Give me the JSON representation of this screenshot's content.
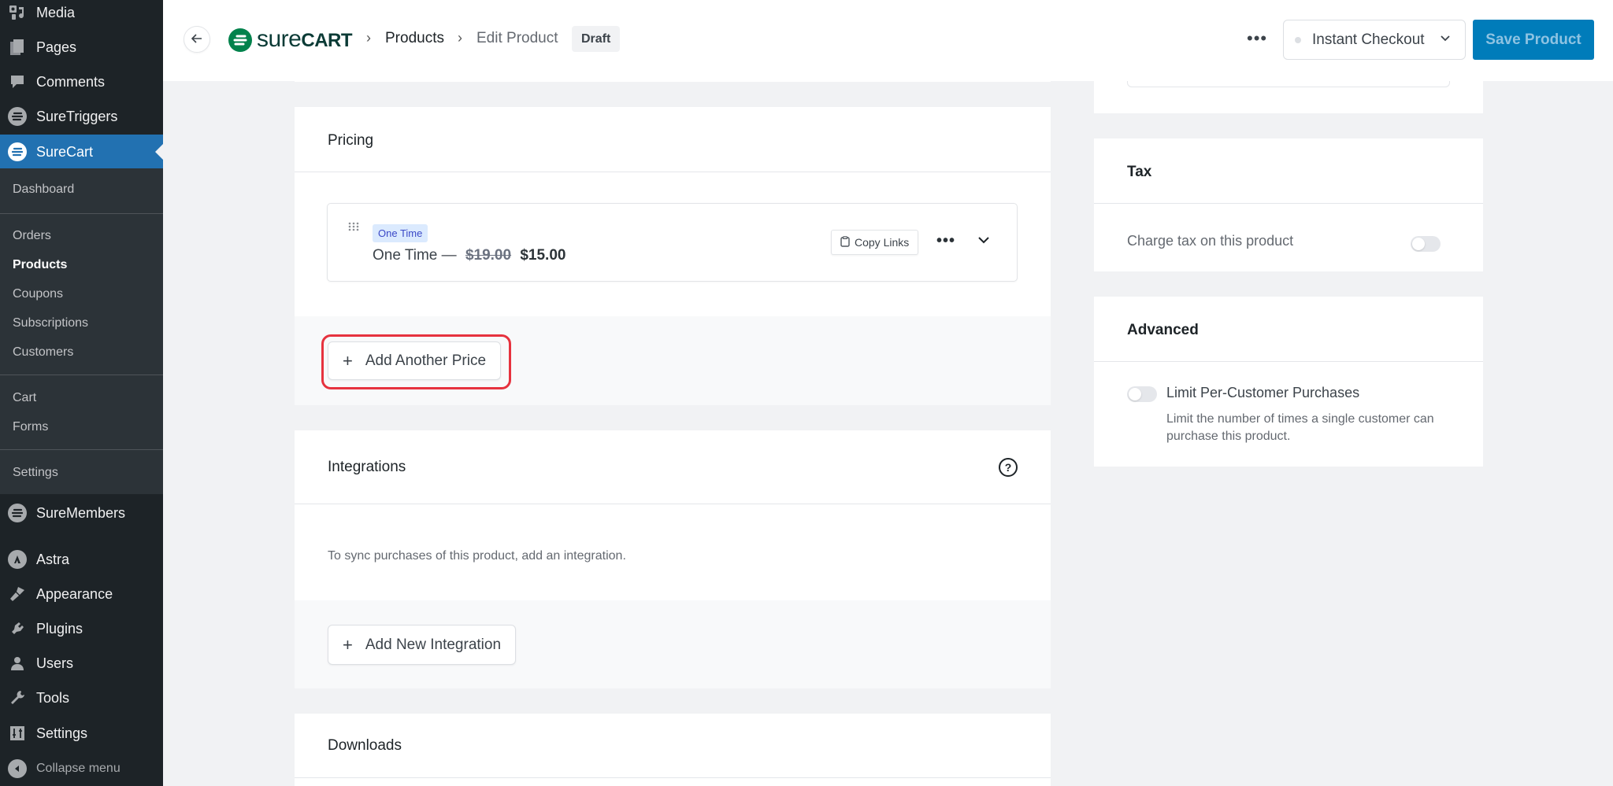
{
  "sidebar": {
    "items": [
      {
        "label": "Media",
        "icon": "media-icon"
      },
      {
        "label": "Pages",
        "icon": "pages-icon"
      },
      {
        "label": "Comments",
        "icon": "comments-icon"
      },
      {
        "label": "SureTriggers",
        "icon": "suretriggers-icon"
      },
      {
        "label": "SureCart",
        "icon": "surecart-icon",
        "active": true
      },
      {
        "label": "SureMembers",
        "icon": "suremembers-icon"
      },
      {
        "label": "Astra",
        "icon": "astra-icon"
      },
      {
        "label": "Appearance",
        "icon": "appearance-icon"
      },
      {
        "label": "Plugins",
        "icon": "plugins-icon"
      },
      {
        "label": "Users",
        "icon": "users-icon"
      },
      {
        "label": "Tools",
        "icon": "tools-icon"
      },
      {
        "label": "Settings",
        "icon": "settings-icon"
      }
    ],
    "submenu": [
      {
        "label": "Dashboard"
      },
      {
        "label": "Orders"
      },
      {
        "label": "Products",
        "current": true
      },
      {
        "label": "Coupons"
      },
      {
        "label": "Subscriptions"
      },
      {
        "label": "Customers"
      },
      {
        "label": "Cart"
      },
      {
        "label": "Forms"
      },
      {
        "label": "Settings"
      }
    ],
    "collapse_label": "Collapse menu"
  },
  "header": {
    "logo_light": "sure",
    "logo_bold": "CART",
    "breadcrumb": [
      "Products",
      "Edit Product"
    ],
    "status_badge": "Draft",
    "more_label": "•••",
    "checkout_select": "Instant Checkout",
    "save_label": "Save Product"
  },
  "pricing": {
    "title": "Pricing",
    "price": {
      "tag": "One Time",
      "name": "One Time —",
      "original": "$19.00",
      "current": "$15.00",
      "copy_links_label": "Copy Links"
    },
    "add_price_label": "Add Another Price"
  },
  "integrations": {
    "title": "Integrations",
    "help": "?",
    "empty_text": "To sync purchases of this product, add an integration.",
    "add_label": "Add New Integration"
  },
  "downloads": {
    "title": "Downloads"
  },
  "tax": {
    "title": "Tax",
    "toggle_label": "Charge tax on this product",
    "enabled": false
  },
  "advanced": {
    "title": "Advanced",
    "limit_label": "Limit Per-Customer Purchases",
    "limit_desc": "Limit the number of times a single customer can purchase this product.",
    "enabled": false
  },
  "colors": {
    "sidebar_bg": "#1d2327",
    "sidebar_active": "#2271b1",
    "brand_green": "#01824c",
    "primary_button": "#007cba",
    "highlight_ring": "#e6323e",
    "tag_bg": "#dbeafe",
    "tag_text": "#3b49c7"
  }
}
